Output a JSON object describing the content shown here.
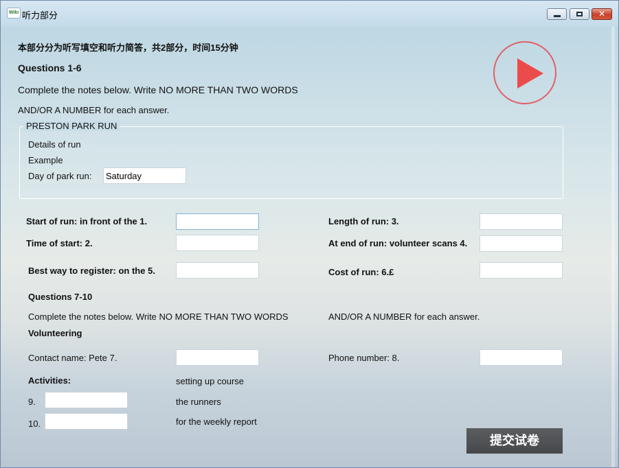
{
  "window": {
    "title": "听力部分",
    "app_icon_text": "Wiki"
  },
  "header": {
    "intro": "本部分分为听写填空和听力简答，共2部分，时间15分钟",
    "section1_heading": "Questions 1-6",
    "section1_instructions_line1": "Complete the notes below. Write NO MORE THAN TWO WORDS",
    "section1_instructions_line2": "AND/OR A NUMBER for each answer."
  },
  "example_box": {
    "legend": "PRESTON PARK RUN",
    "line1": "Details of run",
    "line2": "Example",
    "day_label": "Day of park run:",
    "day_value": "Saturday"
  },
  "questions_1_6": {
    "q1_label": "Start of run:  in front of the 1.",
    "q2_label": "Time of start: 2.",
    "q5_label": "Best way to register: on the 5.",
    "q3_label": "Length of run: 3.",
    "q4_label": "At end of run: volunteer scans 4.",
    "q6_label": "Cost of run: 6.£",
    "q1_value": "",
    "q2_value": "",
    "q3_value": "",
    "q4_value": "",
    "q5_value": "",
    "q6_value": ""
  },
  "section2": {
    "heading": "Questions 7-10",
    "instructions_left": "Complete the notes below. Write NO MORE THAN TWO WORDS",
    "instructions_right": "AND/OR A NUMBER for each answer.",
    "subheading": "Volunteering",
    "q7_label": "Contact name: Pete 7.",
    "q8_label": "Phone number: 8.",
    "activities_label": "Activities:",
    "activity1": "setting up course",
    "q9_num": "9.",
    "activity2": "the runners",
    "q10_num": "10.",
    "activity3": "for the weekly report",
    "q7_value": "",
    "q8_value": "",
    "q9_value": "",
    "q10_value": ""
  },
  "submit_label": "提交试卷",
  "colors": {
    "play_accent": "#ec4b4b",
    "submit_bg": "#505255"
  },
  "icons": {
    "play": "play-icon",
    "minimize": "minimize-icon",
    "maximize": "maximize-icon",
    "close": "close-icon"
  }
}
